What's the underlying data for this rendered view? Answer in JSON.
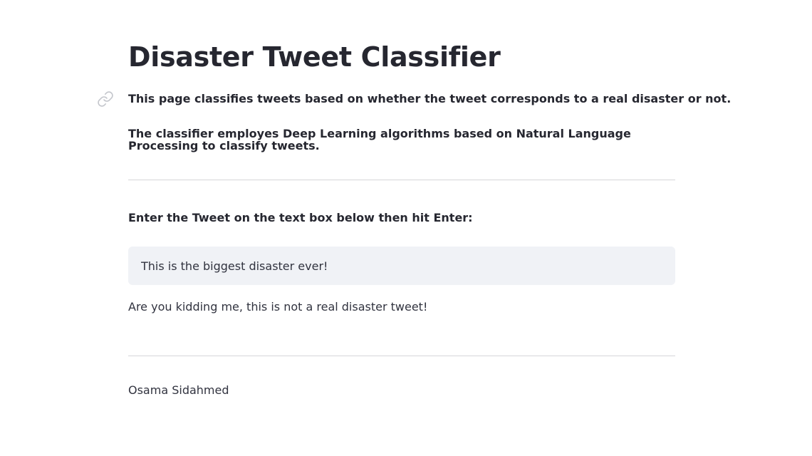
{
  "page": {
    "title": "Disaster Tweet Classifier",
    "description_1": "This page classifies tweets based on whether the tweet corresponds to a real disaster or not.",
    "description_2": "The classifier employes Deep Learning algorithms based on Natural Language Processing to classify tweets."
  },
  "form": {
    "prompt_label": "Enter the Tweet on the text box below then hit Enter:",
    "input_value": "This is the biggest disaster ever!"
  },
  "result": {
    "message": "Are you kidding me, this is not a real disaster tweet!"
  },
  "footer": {
    "author": "Osama Sidahmed"
  },
  "icons": {
    "anchor": "link-icon"
  },
  "colors": {
    "text": "#262730",
    "body_text": "#31333f",
    "input_bg": "#f0f2f6",
    "divider": "#d6d6d9",
    "icon": "#c4c6cc"
  }
}
